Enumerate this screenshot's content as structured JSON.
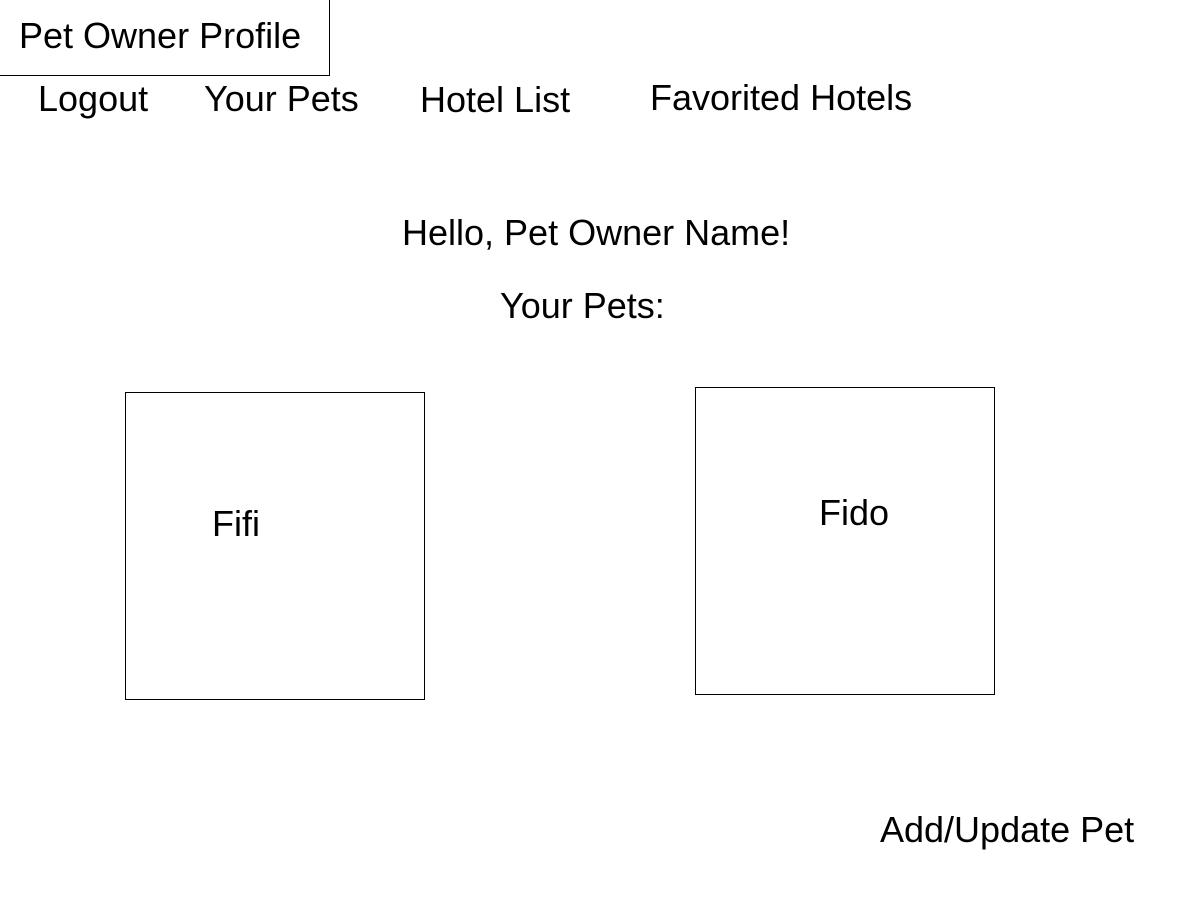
{
  "header": {
    "title": "Pet Owner Profile"
  },
  "nav": {
    "logout": "Logout",
    "your_pets": "Your Pets",
    "hotel_list": "Hotel List",
    "favorited_hotels": "Favorited Hotels"
  },
  "main": {
    "greeting": "Hello, Pet Owner Name!",
    "pets_heading": "Your Pets:",
    "pets": [
      {
        "name": "Fifi"
      },
      {
        "name": "Fido"
      }
    ],
    "add_update_label": "Add/Update Pet"
  }
}
